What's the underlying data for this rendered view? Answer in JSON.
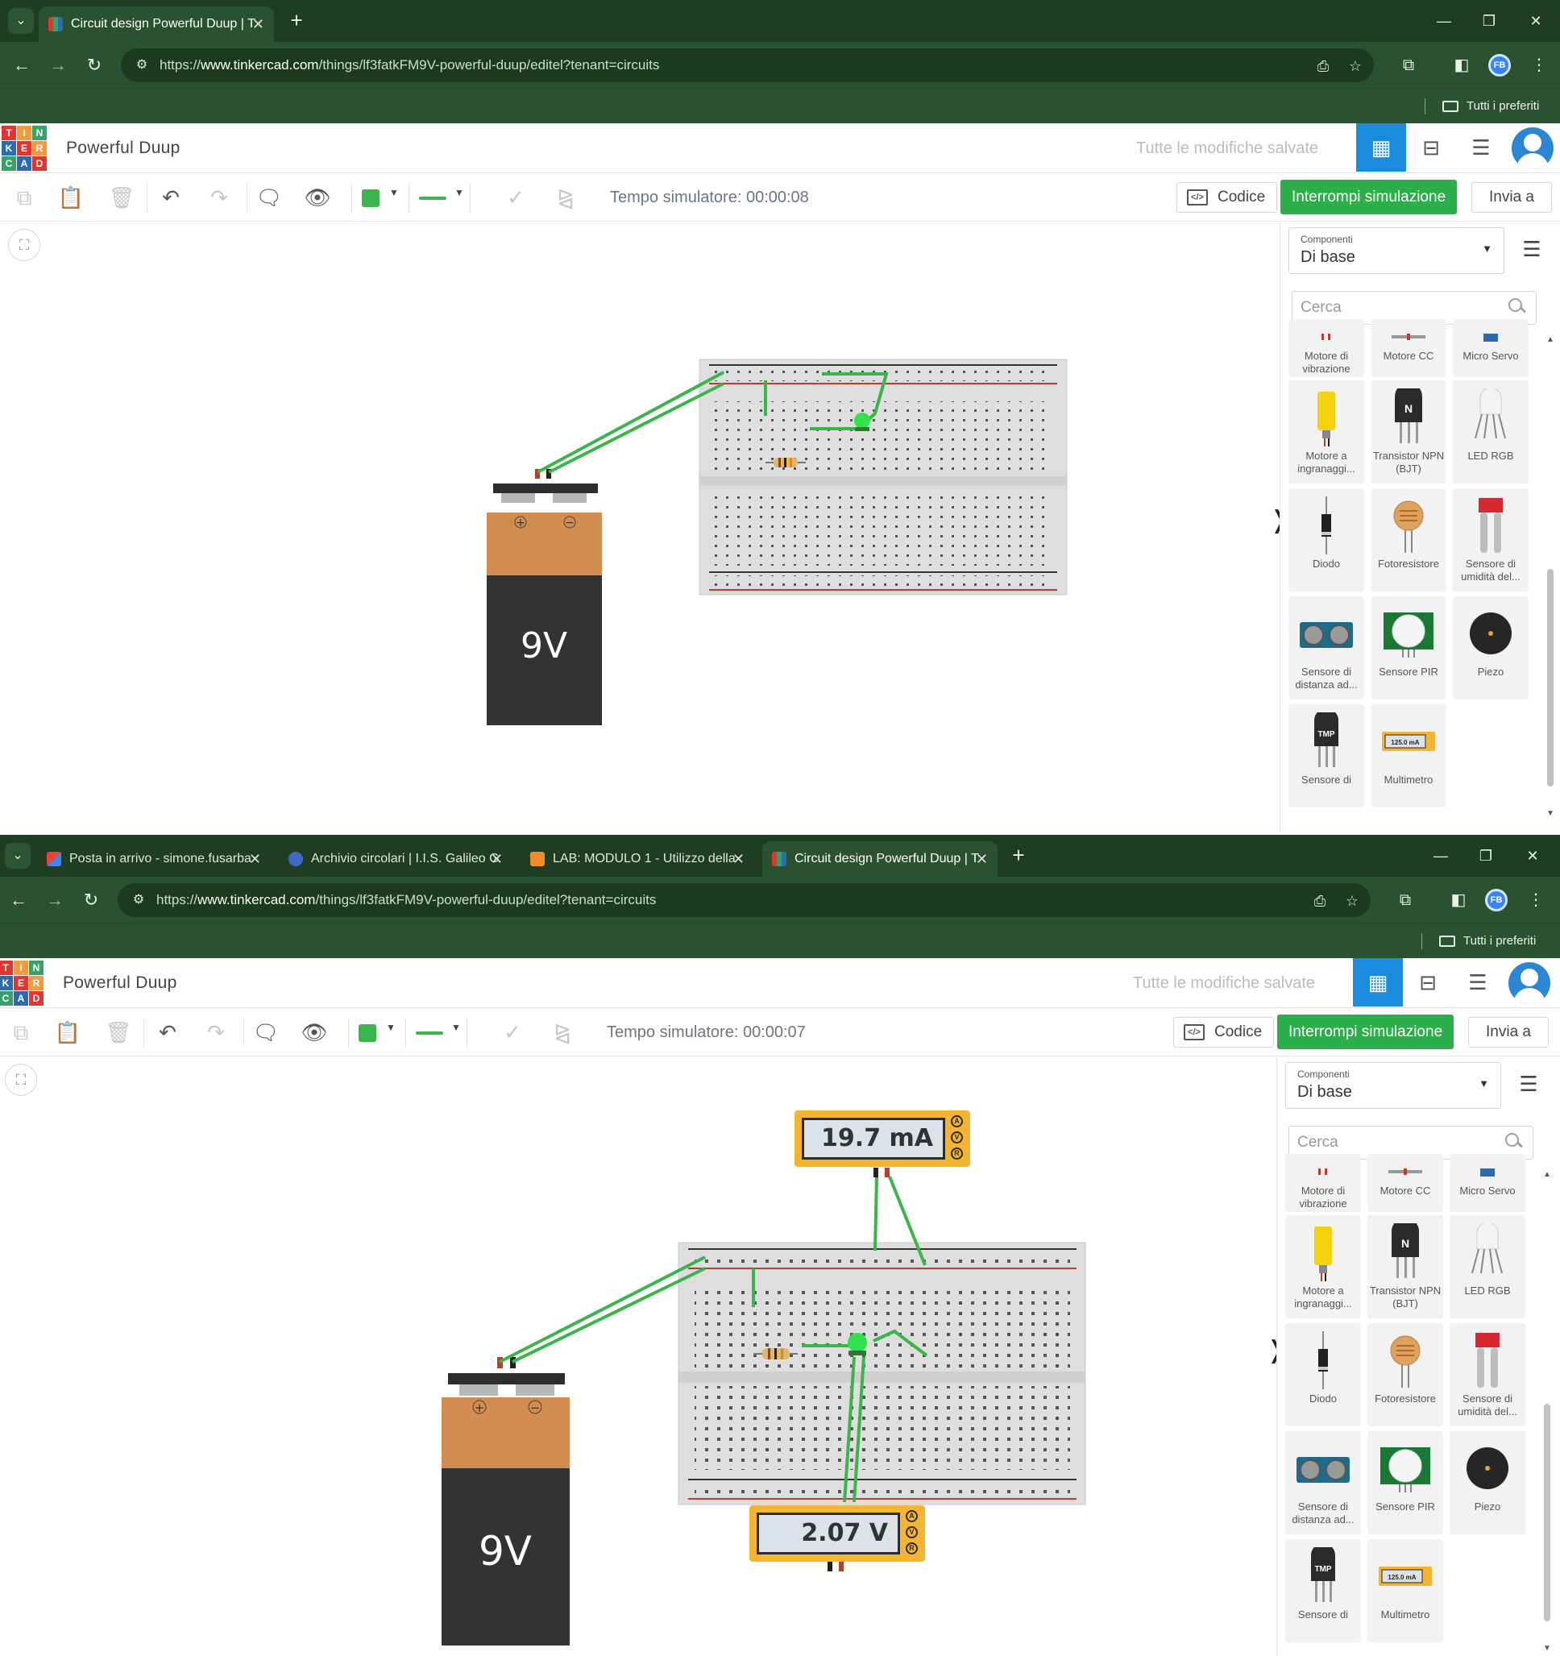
{
  "shots": [
    {
      "tabs": [
        {
          "title": "Circuit design Powerful Duup | T",
          "active": true
        }
      ],
      "url_prefix": "https://",
      "url_host": "www.tinkercad.com",
      "url_path": "/things/lf3fatkFM9V-powerful-duup/editel?tenant=circuits",
      "bookmarks_all": "Tutti i preferiti",
      "project_name": "Powerful Duup",
      "save_status": "Tutte le modifiche salvate",
      "profile_initials": "FB",
      "sim_time": "Tempo simulatore: 00:00:08",
      "code_label": "Codice",
      "stop_label": "Interrompi simulazione",
      "send_label": "Invia a",
      "battery_label": "9V",
      "meters": []
    },
    {
      "tabs": [
        {
          "title": "Posta in arrivo - simone.fusarba",
          "active": false
        },
        {
          "title": "Archivio circolari | I.I.S. Galileo G",
          "active": false
        },
        {
          "title": "LAB: MODULO 1 - Utilizzo della",
          "active": false
        },
        {
          "title": "Circuit design Powerful Duup | T",
          "active": true
        }
      ],
      "url_prefix": "https://",
      "url_host": "www.tinkercad.com",
      "url_path": "/things/lf3fatkFM9V-powerful-duup/editel?tenant=circuits",
      "bookmarks_all": "Tutti i preferiti",
      "project_name": "Powerful Duup",
      "save_status": "Tutte le modifiche salvate",
      "profile_initials": "FB",
      "sim_time": "Tempo simulatore: 00:00:07",
      "code_label": "Codice",
      "stop_label": "Interrompi simulazione",
      "send_label": "Invia a",
      "battery_label": "9V",
      "meters": [
        {
          "reading": "19.7 mA",
          "knobs": [
            "A",
            "V",
            "R"
          ]
        },
        {
          "reading": "2.07 V",
          "knobs": [
            "A",
            "V",
            "R"
          ]
        }
      ]
    }
  ],
  "logo_letters": [
    "T",
    "I",
    "N",
    "K",
    "E",
    "R",
    "C",
    "A",
    "D"
  ],
  "logo_colors": [
    "#e3342f",
    "#f6993f",
    "#38a169",
    "#2b6cb0",
    "#e3342f",
    "#f6993f",
    "#38a169",
    "#2b6cb0",
    "#e3342f"
  ],
  "panel": {
    "category_caption": "Componenti",
    "category_value": "Di base",
    "search_placeholder": "Cerca",
    "components": [
      {
        "label": "Motore di vibrazione",
        "icon": "vibration-motor-icon",
        "partial": true
      },
      {
        "label": "Motore CC",
        "icon": "dc-motor-icon",
        "partial": true
      },
      {
        "label": "Micro Servo",
        "icon": "micro-servo-icon",
        "partial": true
      },
      {
        "label": "Motore a ingranaggi...",
        "icon": "gear-motor-icon"
      },
      {
        "label": "Transistor NPN (BJT)",
        "icon": "npn-transistor-icon"
      },
      {
        "label": "LED RGB",
        "icon": "rgb-led-icon"
      },
      {
        "label": "Diodo",
        "icon": "diode-icon"
      },
      {
        "label": "Fotoresistore",
        "icon": "photoresistor-icon"
      },
      {
        "label": "Sensore di umidità del...",
        "icon": "soil-moisture-sensor-icon"
      },
      {
        "label": "Sensore di distanza ad...",
        "icon": "ultrasonic-sensor-icon"
      },
      {
        "label": "Sensore PIR",
        "icon": "pir-sensor-icon"
      },
      {
        "label": "Piezo",
        "icon": "piezo-icon"
      },
      {
        "label": "Sensore di",
        "icon": "temperature-sensor-icon"
      },
      {
        "label": "Multimetro",
        "icon": "multimeter-icon"
      }
    ],
    "component_icon_text": {
      "transistor": "N",
      "temperature": "TMP",
      "multimeter": "125.0 mA"
    }
  },
  "colors": {
    "chrome_dark": "#1e3d22",
    "chrome": "#2a5130",
    "accent_blue": "#1a8cde",
    "sim_green": "#2cae4a",
    "wire_green": "#3ab54a",
    "battery_top": "#d38d51",
    "battery_body": "#333333",
    "meter_orange": "#f5b530",
    "breadboard": "#dedede"
  }
}
